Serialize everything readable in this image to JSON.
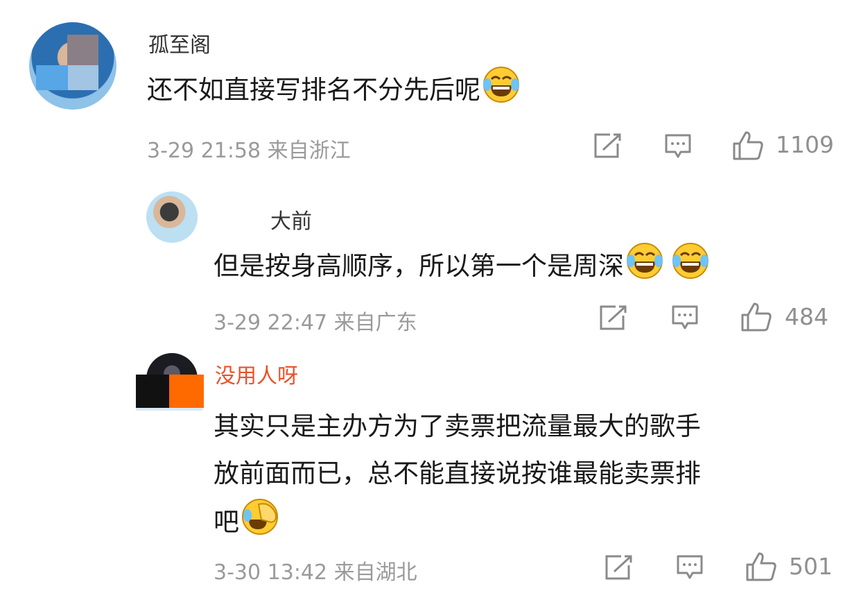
{
  "comments": [
    {
      "username": "孤至阁",
      "text": "还不如直接写排名不分先后呢",
      "emoji": "laughing-tears",
      "date": "3-29",
      "time": "21:58",
      "location": "来自浙江",
      "likes": "1109"
    },
    {
      "username": "大前",
      "text": "但是按身高顺序，所以第一个是周深",
      "emoji": "laughing-tears",
      "date": "3-29",
      "time": "22:47",
      "location": "来自广东",
      "likes": "484"
    },
    {
      "username": "没用人呀",
      "text_lines": [
        "其实只是主办方为了卖票把流量最大的歌手",
        "放前面而已，总不能直接说按谁最能卖票排",
        "吧"
      ],
      "emoji": "facepalm-laugh",
      "date": "3-30",
      "time": "13:42",
      "location": "来自湖北",
      "likes": "501"
    }
  ],
  "icons": {
    "share": "share-icon",
    "reply": "comment-icon",
    "like": "thumbs-up-icon"
  },
  "colors": {
    "text": "#1a1a1a",
    "meta": "#9a9a9a",
    "icon": "#8a8a8a",
    "emoji": "#ffcc33"
  }
}
